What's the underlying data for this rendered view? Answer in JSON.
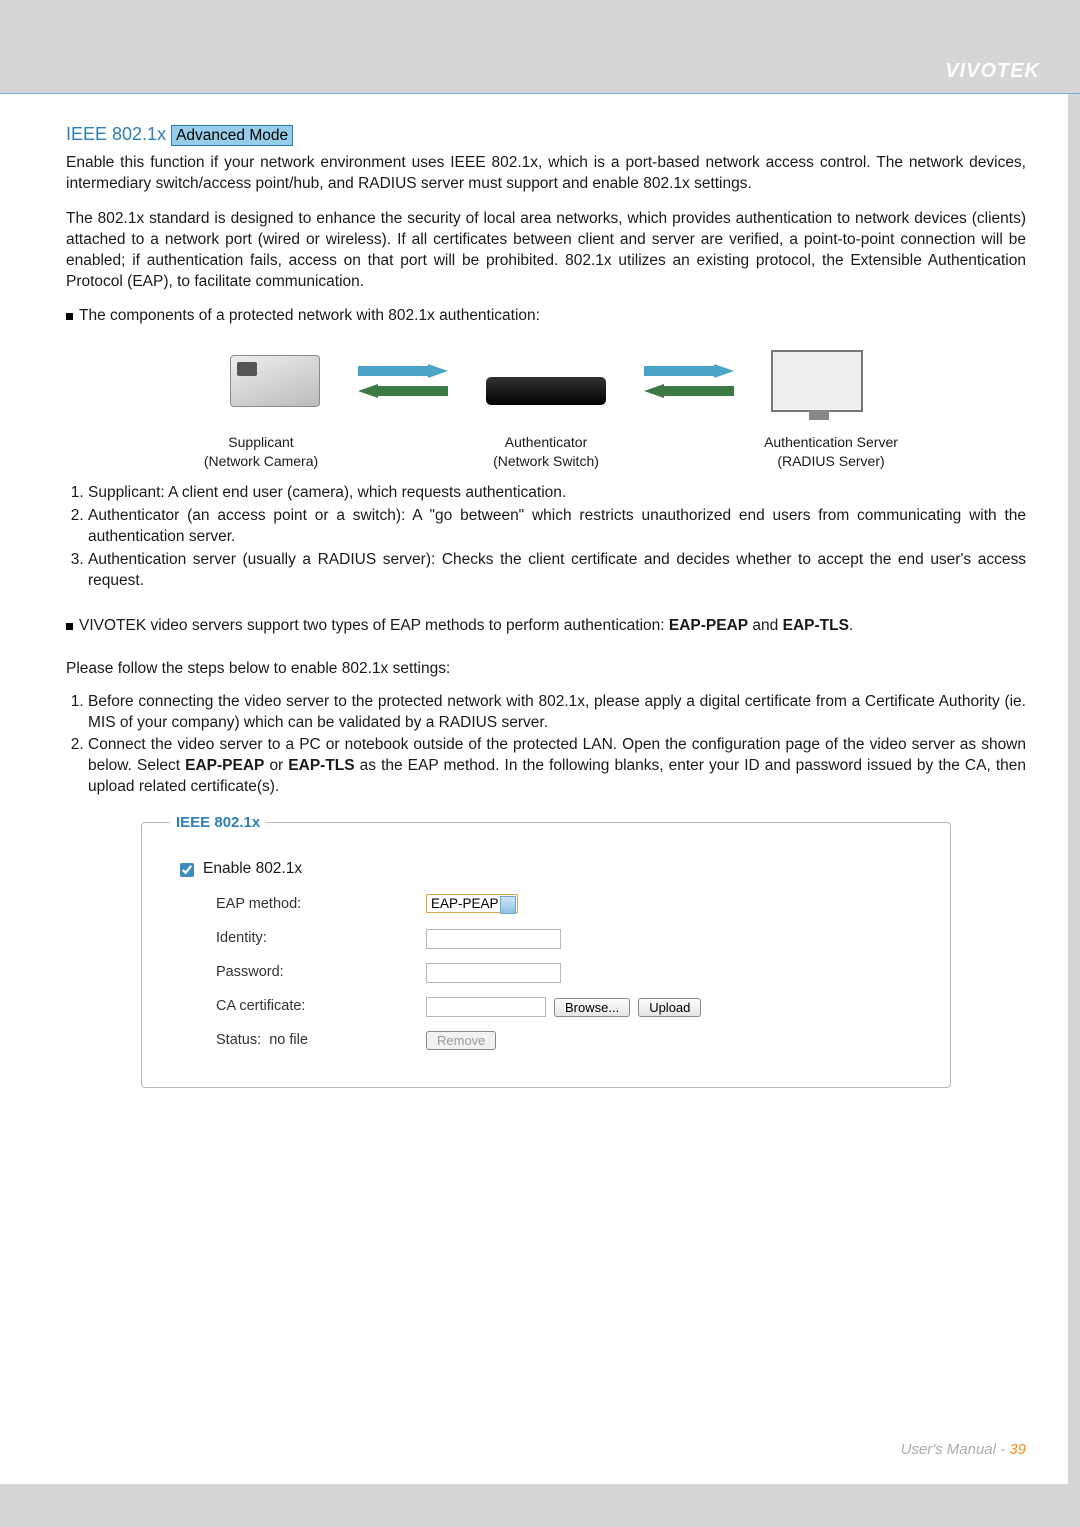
{
  "brand": "VIVOTEK",
  "section": {
    "title_prefix": "IEEE 802.1x",
    "badge": "Advanced Mode"
  },
  "paragraphs": {
    "p1": "Enable this function if your network environment uses IEEE 802.1x, which is a port-based network access control. The network devices, intermediary switch/access point/hub, and RADIUS server must support and enable 802.1x settings.",
    "p2": "The 802.1x standard is designed to enhance the security of local area networks, which provides authentication to network devices (clients) attached to a network port (wired or wireless). If all certificates between client and server are verified, a point-to-point connection will be enabled; if authentication fails, access on that port will be prohibited. 802.1x utilizes an existing protocol, the Extensible Authentication Protocol (EAP), to facilitate communication.",
    "components_intro": "The components of a protected network with 802.1x authentication:"
  },
  "diagram": {
    "supplicant": {
      "title": "Supplicant",
      "sub": "(Network Camera)"
    },
    "authenticator": {
      "title": "Authenticator",
      "sub": "(Network Switch)"
    },
    "server": {
      "title": "Authentication Server",
      "sub": "(RADIUS Server)"
    }
  },
  "defs": {
    "d1": "Supplicant: A client end user (camera), which requests authentication.",
    "d2": "Authenticator (an access point or a switch): A \"go between\" which restricts unauthorized end users from communicating with the authentication server.",
    "d3": "Authentication server (usually a RADIUS server): Checks the client certificate and decides whether to accept the end user's access request."
  },
  "eap_line": {
    "prefix": "VIVOTEK video servers support two types of EAP methods to perform authentication: ",
    "b1": "EAP-PEAP",
    "mid": " and ",
    "b2": "EAP-TLS",
    "suffix": "."
  },
  "steps": {
    "intro": "Please follow the steps below to enable 802.1x settings:",
    "s1": "Before connecting the video server to the protected network with 802.1x, please apply a digital certificate from a Certificate Authority (ie. MIS of your company) which can be validated by a RADIUS server.",
    "s2a": "Connect the video server to a PC or notebook outside of the protected LAN. Open the configuration page of the video server as shown below. Select ",
    "s2b1": "EAP-PEAP",
    "s2mid": " or ",
    "s2b2": "EAP-TLS",
    "s2c": " as the EAP method. In the following blanks, enter your ID and password issued by the CA, then upload related certificate(s)."
  },
  "panel": {
    "legend": "IEEE 802.1x",
    "enable_label": "Enable 802.1x",
    "enable_checked": true,
    "eap_method_label": "EAP method:",
    "eap_method_value": "EAP-PEAP",
    "identity_label": "Identity:",
    "identity_value": "",
    "password_label": "Password:",
    "password_value": "",
    "ca_label": "CA certificate:",
    "ca_file_value": "",
    "browse_btn": "Browse...",
    "upload_btn": "Upload",
    "status_prefix": "Status:",
    "status_value": "no file",
    "remove_btn": "Remove"
  },
  "footer": {
    "manual": "User's Manual - ",
    "page": "39"
  }
}
